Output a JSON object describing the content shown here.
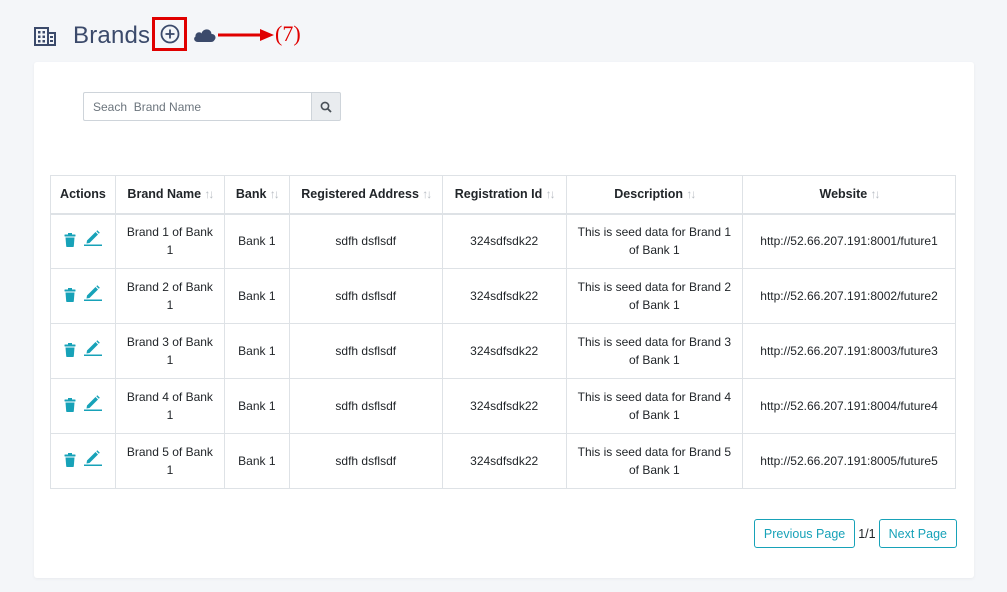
{
  "header": {
    "title": "Brands",
    "icon": "building-icon",
    "annotation": "(7)"
  },
  "search": {
    "placeholder": "Seach  Brand Name",
    "value": ""
  },
  "table": {
    "columns": [
      "Actions",
      "Brand Name",
      "Bank",
      "Registered Address",
      "Registration Id",
      "Description",
      "Website"
    ],
    "sortable": [
      false,
      true,
      true,
      true,
      true,
      true,
      true
    ],
    "rows": [
      {
        "brand_name": "Brand 1 of Bank 1",
        "bank": "Bank 1",
        "address": "sdfh dsflsdf",
        "reg_id": "324sdfsdk22",
        "description": "This is seed data for Brand 1 of Bank 1",
        "website": "http://52.66.207.191:8001/future1"
      },
      {
        "brand_name": "Brand 2 of Bank 1",
        "bank": "Bank 1",
        "address": "sdfh dsflsdf",
        "reg_id": "324sdfsdk22",
        "description": "This is seed data for Brand 2 of Bank 1",
        "website": "http://52.66.207.191:8002/future2"
      },
      {
        "brand_name": "Brand 3 of Bank 1",
        "bank": "Bank 1",
        "address": "sdfh dsflsdf",
        "reg_id": "324sdfsdk22",
        "description": "This is seed data for Brand 3 of Bank 1",
        "website": "http://52.66.207.191:8003/future3"
      },
      {
        "brand_name": "Brand 4 of Bank 1",
        "bank": "Bank 1",
        "address": "sdfh dsflsdf",
        "reg_id": "324sdfsdk22",
        "description": "This is seed data for Brand 4 of Bank 1",
        "website": "http://52.66.207.191:8004/future4"
      },
      {
        "brand_name": "Brand 5 of Bank 1",
        "bank": "Bank 1",
        "address": "sdfh dsflsdf",
        "reg_id": "324sdfsdk22",
        "description": "This is seed data for Brand 5 of Bank 1",
        "website": "http://52.66.207.191:8005/future5"
      }
    ]
  },
  "pagination": {
    "prev_label": "Previous Page",
    "page_info": "1/1",
    "next_label": "Next Page"
  },
  "colors": {
    "title": "#3b4a6b",
    "accent": "#17a2b8",
    "annotation": "#e00000"
  }
}
